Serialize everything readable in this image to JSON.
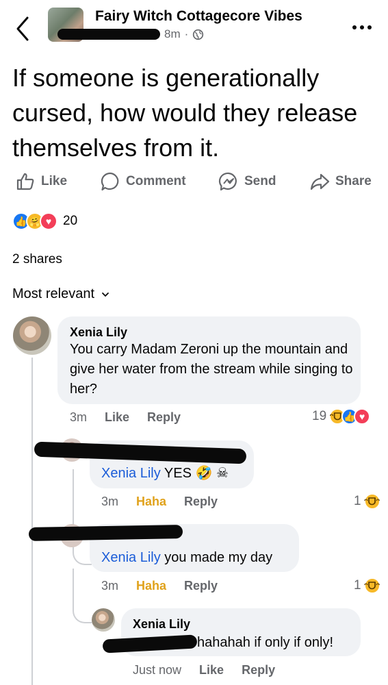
{
  "header": {
    "group_name": "Fairy Witch Cottagecore Vibes",
    "time": "8m",
    "dot": "·"
  },
  "post": {
    "text": "If someone is generationally cursed, how would they release themselves from it."
  },
  "actions": {
    "like": "Like",
    "comment": "Comment",
    "send": "Send",
    "share": "Share"
  },
  "reactions": {
    "count": "20",
    "types": [
      "like",
      "care",
      "love"
    ]
  },
  "shares": "2 shares",
  "sort": {
    "label": "Most relevant"
  },
  "comments": [
    {
      "name": "Xenia Lily",
      "text": "You carry Madam Zeroni up the mountain and give her water from the stream while singing to her?",
      "time": "3m",
      "like": "Like",
      "reply": "Reply",
      "reaction_count": "19",
      "reactions": [
        "haha",
        "like",
        "love"
      ]
    }
  ],
  "replies": [
    {
      "mention": "Xenia Lily",
      "text": "YES",
      "emoji": "🤣 ☠",
      "time": "3m",
      "reaction_label": "Haha",
      "reply": "Reply",
      "reaction_count": "1"
    },
    {
      "mention": "Xenia Lily",
      "text": "you made my day",
      "time": "3m",
      "reaction_label": "Haha",
      "reply": "Reply",
      "reaction_count": "1"
    },
    {
      "name": "Xenia Lily",
      "text": "hahahah if only if only!",
      "time": "Just now",
      "like": "Like",
      "reply": "Reply"
    }
  ],
  "colors": {
    "accent": "#1877f2",
    "mention": "#1a5cd8",
    "haha": "#e0a21c",
    "muted": "#65676b",
    "bubble": "#f0f2f5"
  }
}
